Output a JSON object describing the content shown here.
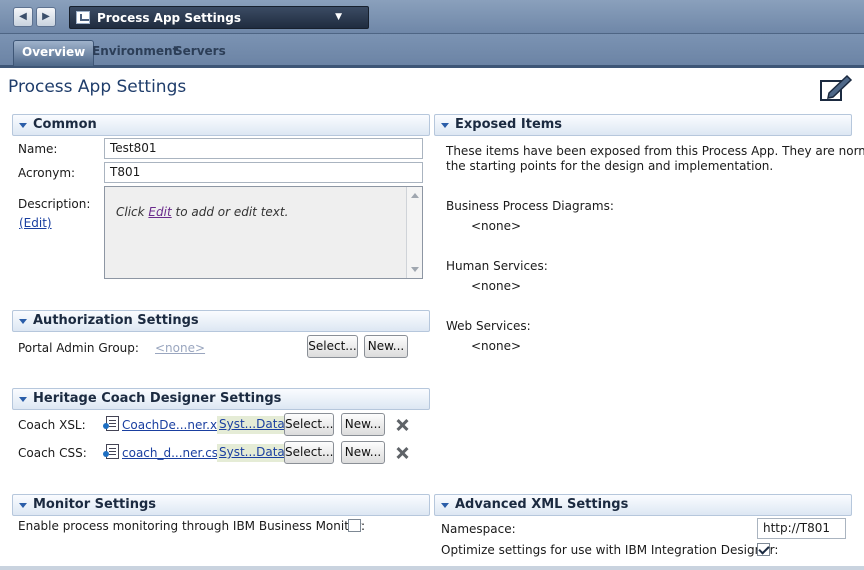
{
  "toolbar": {
    "back_icon": "back-arrow-icon",
    "forward_icon": "forward-arrow-icon",
    "app_selector": "Process App Settings"
  },
  "tabs": [
    {
      "label": "Overview",
      "active": true
    },
    {
      "label": "Environment",
      "active": false
    },
    {
      "label": "Servers",
      "active": false
    }
  ],
  "page": {
    "title": "Process App Settings",
    "edit_icon": "edit-pencil-icon"
  },
  "common": {
    "heading": "Common",
    "name_label": "Name:",
    "name_value": "Test801",
    "acronym_label": "Acronym:",
    "acronym_value": "T801",
    "description_label": "Description:",
    "description_edit_link": "(Edit)",
    "description_prefix": "Click ",
    "description_link": "Edit",
    "description_suffix": " to add or edit text."
  },
  "authorization": {
    "heading": "Authorization Settings",
    "portal_admin_label": "Portal Admin Group:",
    "portal_admin_value": "<none>",
    "select_button": "Select...",
    "new_button": "New..."
  },
  "heritage": {
    "heading": "Heritage Coach Designer Settings",
    "xsl_label": "Coach XSL:",
    "xsl_file": "CoachDe...ner.xsl",
    "xsl_source": "Syst...Data",
    "css_label": "Coach CSS:",
    "css_file": "coach_d...ner.css",
    "css_source": "Syst...Data",
    "select_button": "Select...",
    "new_button": "New..."
  },
  "monitor": {
    "heading": "Monitor Settings",
    "enable_label": "Enable process monitoring through IBM Business Monitor:",
    "enable_checked": false
  },
  "exposed": {
    "heading": "Exposed Items",
    "intro_line1": "These items have been exposed from this Process App. They are normally",
    "intro_line2": "the starting points for the design and implementation.",
    "bpd_label": "Business Process Diagrams:",
    "bpd_value": "<none>",
    "human_label": "Human Services:",
    "human_value": "<none>",
    "web_label": "Web Services:",
    "web_value": "<none>"
  },
  "advanced_xml": {
    "heading": "Advanced XML Settings",
    "namespace_label": "Namespace:",
    "namespace_value": "http://T801",
    "optimize_label": "Optimize settings for use with IBM Integration Designer:",
    "optimize_checked": true
  }
}
